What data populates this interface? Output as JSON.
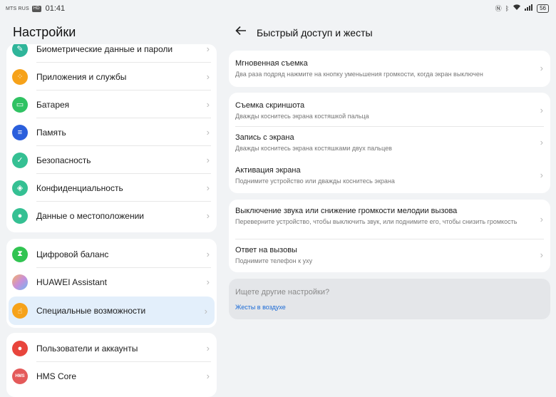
{
  "status_bar": {
    "carrier": "MTS RUS",
    "network_badge": "HD",
    "time": "01:41",
    "icons": [
      "nfc-icon",
      "bluetooth-icon",
      "wifi-icon",
      "signal-icon"
    ],
    "battery": "56"
  },
  "left_pane": {
    "title": "Настройки",
    "groups": [
      {
        "items": [
          {
            "label": "Биометрические данные и пароли",
            "icon": "biometric-icon",
            "color": "#2fb59a"
          },
          {
            "label": "Приложения и службы",
            "icon": "apps-icon",
            "color": "#f6a21a"
          },
          {
            "label": "Батарея",
            "icon": "battery-icon",
            "color": "#30c263"
          },
          {
            "label": "Память",
            "icon": "storage-icon",
            "color": "#2b5fdc"
          },
          {
            "label": "Безопасность",
            "icon": "shield-icon",
            "color": "#35c093"
          },
          {
            "label": "Конфиденциальность",
            "icon": "privacy-icon",
            "color": "#35c093"
          },
          {
            "label": "Данные о местоположении",
            "icon": "location-icon",
            "color": "#35c093"
          }
        ]
      },
      {
        "items": [
          {
            "label": "Цифровой баланс",
            "icon": "hourglass-icon",
            "color": "#31c451"
          },
          {
            "label": "HUAWEI Assistant",
            "icon": "assistant-icon",
            "color": "#c98fd9"
          },
          {
            "label": "Специальные возможности",
            "icon": "hand-icon",
            "color": "#f6a21a",
            "active": true
          }
        ]
      },
      {
        "items": [
          {
            "label": "Пользователи и аккаунты",
            "icon": "user-icon",
            "color": "#e8453c"
          },
          {
            "label": "HMS Core",
            "icon": "hms-core-icon",
            "color": "#e45a5a",
            "icon_text": "HMS"
          }
        ]
      }
    ]
  },
  "right_pane": {
    "back_icon": "back-arrow-icon",
    "title": "Быстрый доступ и жесты",
    "cards": [
      {
        "items": [
          {
            "title": "Мгновенная съемка",
            "subtitle": "Два раза подряд нажмите на кнопку уменьшения громкости, когда экран выключен"
          }
        ]
      },
      {
        "items": [
          {
            "title": "Съемка скриншота",
            "subtitle": "Дважды коснитесь экрана костяшкой пальца"
          },
          {
            "title": "Запись с экрана",
            "subtitle": "Дважды коснитесь экрана костяшками двух пальцев"
          },
          {
            "title": "Активация экрана",
            "subtitle": "Поднимите устройство или дважды коснитесь экрана"
          }
        ]
      },
      {
        "items": [
          {
            "title": "Выключение звука или снижение громкости мелодии вызова",
            "subtitle": "Переверните устройство, чтобы выключить звук, или поднимите его, чтобы снизить громкость"
          },
          {
            "title": "Ответ на вызовы",
            "subtitle": "Поднимите телефон к уху"
          }
        ]
      }
    ],
    "hint": {
      "question": "Ищете другие настройки?",
      "link": "Жесты в воздухе"
    }
  },
  "colors": {
    "background": "#f1f3f5",
    "active_row": "#e3effb",
    "link": "#1a6ad6"
  }
}
